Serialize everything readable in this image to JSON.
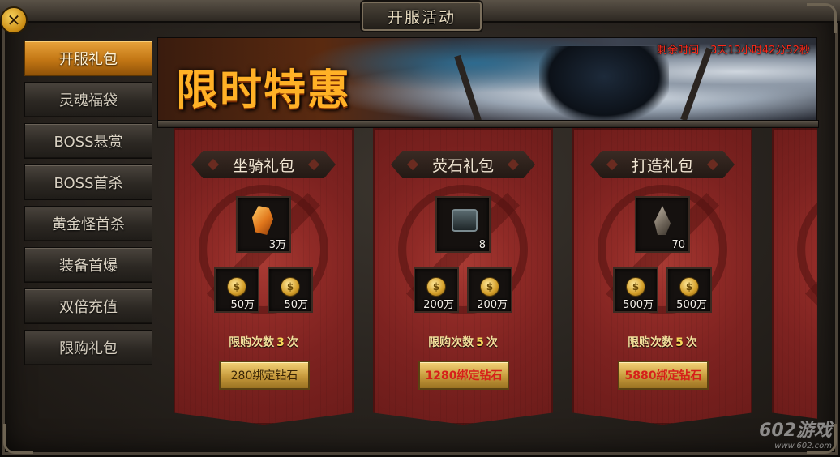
{
  "window": {
    "title": "开服活动"
  },
  "sidebar": {
    "items": [
      {
        "label": "开服礼包",
        "active": true
      },
      {
        "label": "灵魂福袋"
      },
      {
        "label": "BOSS悬赏"
      },
      {
        "label": "BOSS首杀"
      },
      {
        "label": "黄金怪首杀"
      },
      {
        "label": "装备首爆"
      },
      {
        "label": "双倍充值"
      },
      {
        "label": "限购礼包"
      }
    ]
  },
  "banner": {
    "title": "限时特惠",
    "countdown_label": "剩余时间",
    "countdown_value": "3天13小时42分52秒"
  },
  "cards": [
    {
      "name": "坐骑礼包",
      "main_item": {
        "icon": "orange-crystal-icon",
        "qty": "3万"
      },
      "coins": [
        {
          "icon": "gold-coin-icon",
          "qty": "50万"
        },
        {
          "icon": "gold-coin-icon",
          "qty": "50万"
        }
      ],
      "limit_prefix": "限购次数",
      "limit_count": "3",
      "limit_suffix": "次",
      "price": "280绑定钻石"
    },
    {
      "name": "荧石礼包",
      "main_item": {
        "icon": "dark-chest-icon",
        "qty": "8"
      },
      "coins": [
        {
          "icon": "gold-coin-icon",
          "qty": "200万"
        },
        {
          "icon": "gold-coin-icon",
          "qty": "200万"
        }
      ],
      "limit_prefix": "限购次数",
      "limit_count": "5",
      "limit_suffix": "次",
      "price": "1280绑定钻石"
    },
    {
      "name": "打造礼包",
      "main_item": {
        "icon": "stone-shard-icon",
        "qty": "70"
      },
      "coins": [
        {
          "icon": "gold-coin-icon",
          "qty": "500万"
        },
        {
          "icon": "gold-coin-icon",
          "qty": "500万"
        }
      ],
      "limit_prefix": "限购次数",
      "limit_count": "5",
      "limit_suffix": "次",
      "price": "5880绑定钻石"
    }
  ],
  "coin_symbol": "$",
  "watermark": {
    "text": "602游戏",
    "url": "www.602.com"
  },
  "colors": {
    "accent": "#ffb126",
    "countdown": "#ff2a1a",
    "card": "#8f2a26"
  }
}
